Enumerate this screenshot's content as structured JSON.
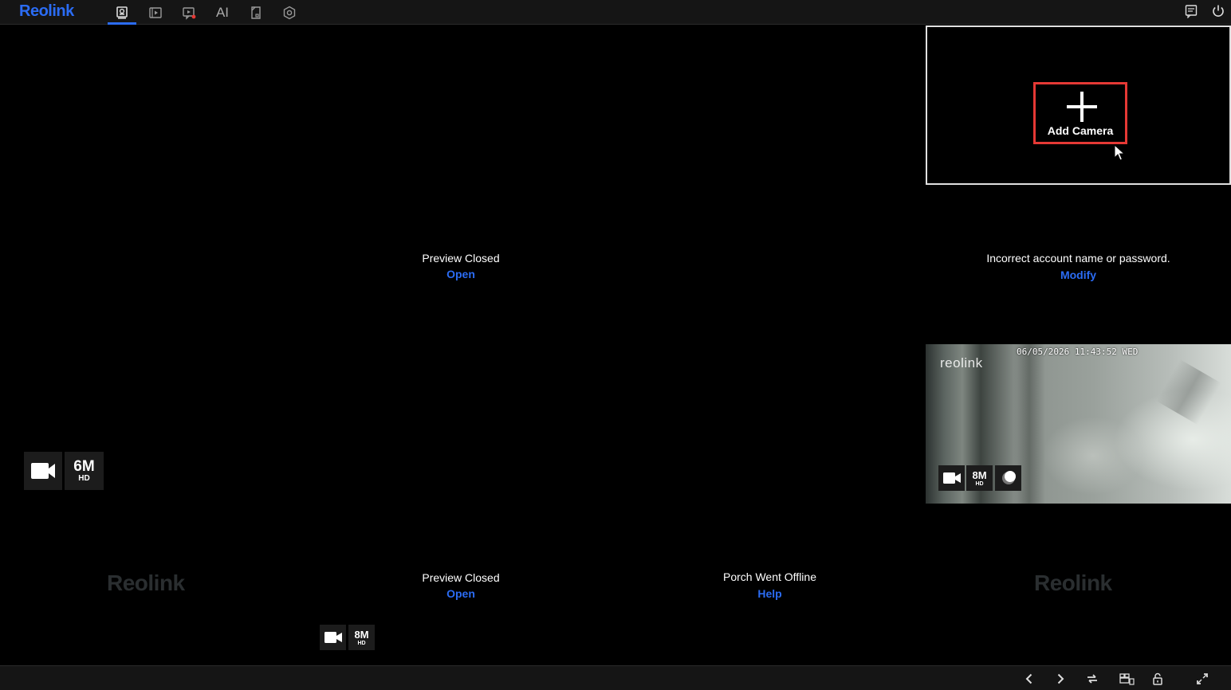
{
  "app": {
    "logo": "Reolink"
  },
  "nav": {
    "tabs": [
      {
        "name": "live-view",
        "active": true
      },
      {
        "name": "playback",
        "active": false
      },
      {
        "name": "alarm-video",
        "active": false
      },
      {
        "name": "ai",
        "label": "AI",
        "active": false
      },
      {
        "name": "file",
        "active": false
      },
      {
        "name": "settings",
        "active": false
      }
    ]
  },
  "cells": {
    "add_camera": {
      "label": "Add Camera"
    },
    "preview_1": {
      "message": "Preview Closed",
      "action": "Open"
    },
    "account_error": {
      "message": "Incorrect account name or password.",
      "action": "Modify"
    },
    "live_feed": {
      "osd_time": "06/05/2026 11:43:52 WED",
      "osd_logo": "reolink",
      "resolution": "8M",
      "quality": "HD"
    },
    "camera_6m": {
      "resolution": "6M",
      "quality": "HD"
    },
    "preview_2": {
      "message": "Preview Closed",
      "action": "Open",
      "resolution": "8M",
      "quality": "HD"
    },
    "offline": {
      "message": "Porch Went Offline",
      "action": "Help"
    },
    "watermark_left": {
      "text": "Reolink"
    },
    "watermark_right": {
      "text": "Reolink"
    }
  },
  "colors": {
    "accent": "#2b6cf4",
    "highlight": "#e53935",
    "bar": "#151515"
  }
}
